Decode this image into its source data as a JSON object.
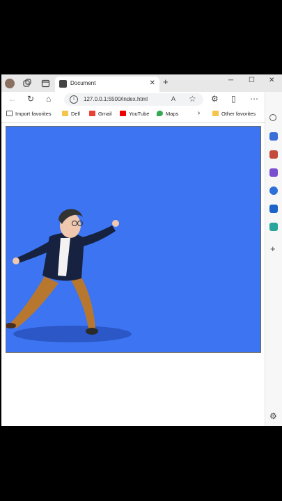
{
  "tab": {
    "title": "Document"
  },
  "address_bar": {
    "url": "127.0.0.1:5500/index.html"
  },
  "favorites": [
    {
      "label": "Import favorites",
      "icon": "import-icon"
    },
    {
      "label": "Dell",
      "icon": "folder-icon"
    },
    {
      "label": "Gmail",
      "icon": "gmail-icon"
    },
    {
      "label": "YouTube",
      "icon": "youtube-icon"
    },
    {
      "label": "Maps",
      "icon": "maps-icon"
    }
  ],
  "other_favorites": "Other favorites",
  "colors": {
    "canvas_bg": "#3c74f2",
    "tab_bar": "#e8e8e8"
  }
}
